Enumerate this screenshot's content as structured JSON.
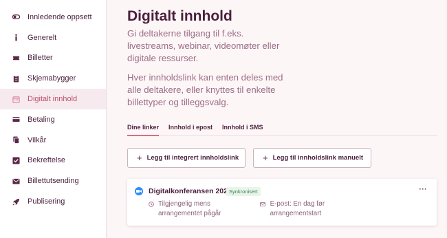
{
  "sidebar": {
    "items": [
      {
        "label": "Innledende oppsett",
        "icon": "toggle-icon"
      },
      {
        "label": "Generelt",
        "icon": "info-icon"
      },
      {
        "label": "Billetter",
        "icon": "ticket-icon"
      },
      {
        "label": "Skjemabygger",
        "icon": "clipboard-icon"
      },
      {
        "label": "Digitalt innhold",
        "icon": "calendar-icon",
        "active": true
      },
      {
        "label": "Betaling",
        "icon": "credit-card-icon"
      },
      {
        "label": "Vilkår",
        "icon": "copy-icon"
      },
      {
        "label": "Bekreftelse",
        "icon": "check-square-icon"
      },
      {
        "label": "Billettutsending",
        "icon": "mail-icon"
      },
      {
        "label": "Publisering",
        "icon": "rocket-icon"
      }
    ]
  },
  "main": {
    "title": "Digitalt innhold",
    "description_1": "Gi deltakerne tilgang til f.eks. livestreams, webinar, videomøter eller digitale ressurser.",
    "description_2": "Hver innholdslink kan enten deles med alle deltakere, eller knyttes til enkelte billettyper og tilleggsvalg.",
    "tabs": [
      {
        "label": "Dine linker",
        "active": true
      },
      {
        "label": "Innhold i epost"
      },
      {
        "label": "Innhold i SMS"
      }
    ],
    "buttons": {
      "add_integrated": "Legg til integrert innholdslink",
      "add_manual": "Legg til innholdslink manuelt",
      "plus": "+"
    },
    "card": {
      "title": "Digitalkonferansen 2023",
      "badge": "Synkronisert",
      "more": "···",
      "availability": "Tilgjengelig mens arrangementet pågår",
      "email": "E-post: En dag før arrangementstart"
    }
  },
  "colors": {
    "accent": "#d66e8a",
    "text": "#4a1f3d",
    "zoom": "#2d8cff",
    "badge_bg": "#e6f6ea"
  }
}
